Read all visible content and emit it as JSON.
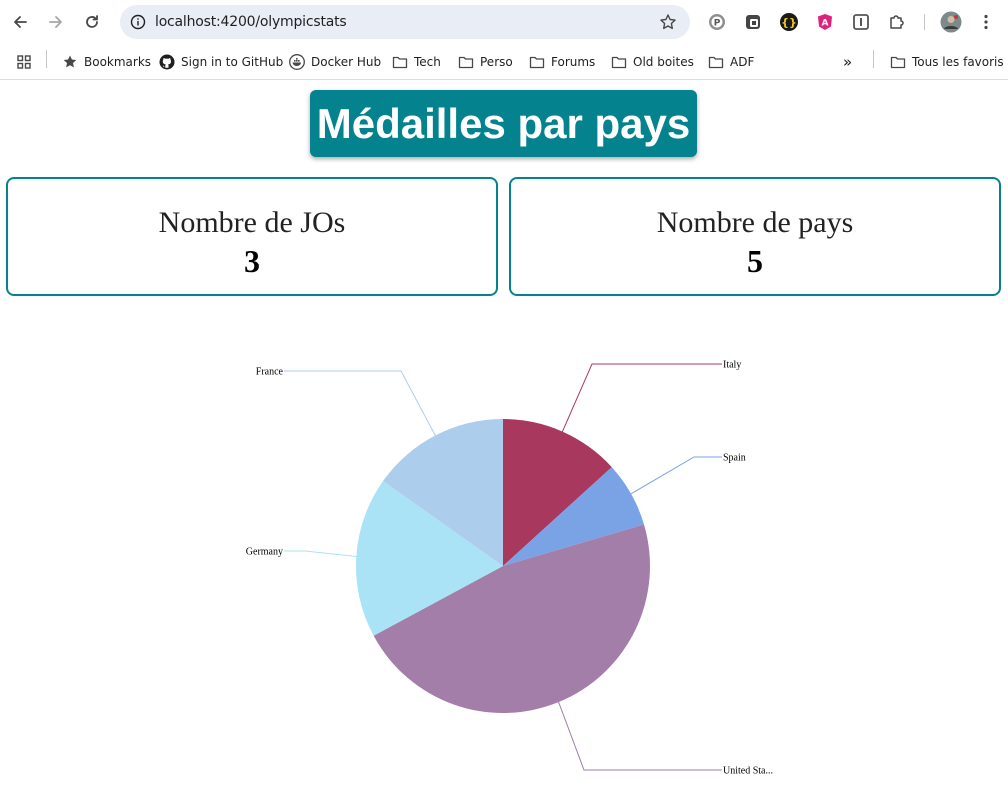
{
  "browser": {
    "url": "localhost:4200/olympicstats",
    "bookmarks": [
      "Bookmarks",
      "Sign in to GitHub",
      "Docker Hub",
      "Tech",
      "Perso",
      "Forums",
      "Old boites",
      "ADF"
    ],
    "other_bookmarks": "Tous les favoris",
    "overflow": "»",
    "icons": [
      "back-icon",
      "forward-icon",
      "reload-icon",
      "site-info-icon",
      "bookmark-star-icon",
      "extension-icons",
      "profile-avatar",
      "menu-kebab-icon"
    ]
  },
  "page": {
    "title": "Médailles par pays",
    "cards": [
      {
        "label": "Nombre de JOs",
        "value": "3"
      },
      {
        "label": "Nombre de pays",
        "value": "5"
      }
    ]
  },
  "chart_data": {
    "type": "pie",
    "slices": [
      {
        "label": "Italy",
        "value": 96,
        "color": "#a8385d"
      },
      {
        "label": "Spain",
        "value": 52,
        "color": "#7aa3e5"
      },
      {
        "label": "United States",
        "display_label": "United Sta...",
        "value": 338,
        "color": "#a27ea8"
      },
      {
        "label": "Germany",
        "value": 128,
        "color": "#aae3f5"
      },
      {
        "label": "France",
        "value": 110,
        "color": "#adcded"
      }
    ]
  }
}
